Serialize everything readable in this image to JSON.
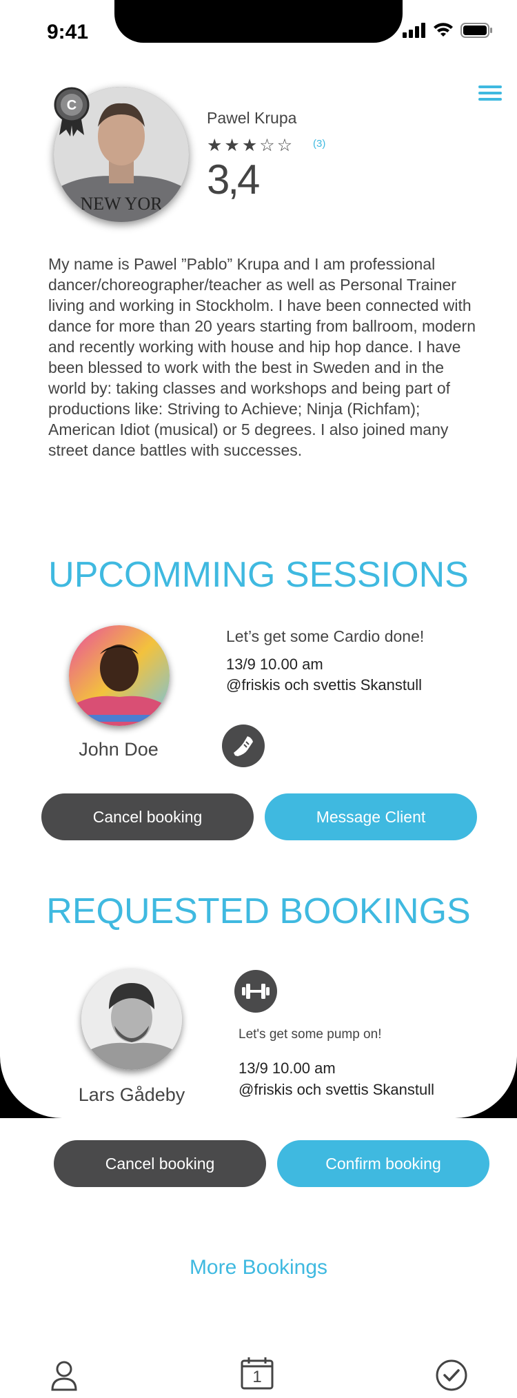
{
  "status_bar": {
    "time": "9:41"
  },
  "profile": {
    "name": "Pawel Krupa",
    "badge_letter": "C",
    "stars_filled": 3,
    "stars_total": 5,
    "review_count": "(3)",
    "rating": "3,4",
    "bio": "My name is Pawel ”Pablo” Krupa and I am professional dancer/choreographer/teacher as well as Personal Trainer living and working in Stockholm. I have been connected with dance for more than 20 years starting from ballroom, modern and recently working with house and hip hop dance. I have been blessed to work with the best in Sweden and in the world by: taking classes and workshops and being part of productions like: Striving to Achieve; Ninja (Richfam); American Idiot (musical) or 5 degrees. I also joined many street dance battles with successes."
  },
  "upcoming": {
    "title": "UPCOMMING SESSIONS",
    "client_name": "John Doe",
    "session_title": "Let’s get some Cardio done!",
    "datetime": "13/9 10.00 am",
    "location": "@friskis och svettis Skanstull",
    "activity_icon": "sneaker-icon",
    "cancel_label": "Cancel booking",
    "message_label": "Message Client"
  },
  "requested": {
    "title": "REQUESTED BOOKINGS",
    "client_name": "Lars Gådeby",
    "session_title": "Let's get some pump on!",
    "datetime": "13/9 10.00 am",
    "location": "@friskis och svettis Skanstull",
    "activity_icon": "dumbbell-icon",
    "cancel_label": "Cancel booking",
    "confirm_label": "Confirm booking"
  },
  "more_bookings": "More Bookings",
  "tab_bar": {
    "calendar_day": "1",
    "items": [
      "profile-icon",
      "calendar-icon",
      "check-circle-icon"
    ]
  },
  "colors": {
    "accent": "#3fb9e0",
    "dark_button": "#4a4a4b",
    "text": "#444444"
  }
}
